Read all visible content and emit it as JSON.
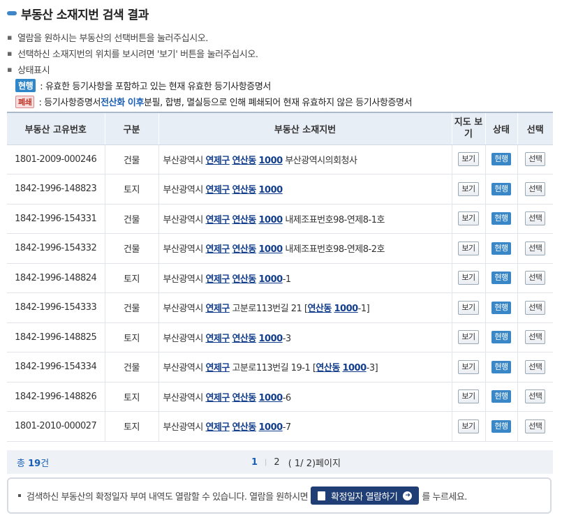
{
  "title": "부동산 소재지번 검색 결과",
  "notes": [
    "열람을 원하시는 부동산의 선택버튼을 눌러주십시오.",
    "선택하신 소재지번의 위치를 보시려면 '보기' 버튼을 눌러주십시오.",
    "상태표시"
  ],
  "legend": {
    "current_badge": "현행",
    "current_text": ": 유효한 등기사항을 포함하고 있는 현재 유효한 등기사항증명서",
    "closed_badge": "폐쇄",
    "closed_text_a": ": 등기사항증명서 ",
    "closed_text_highlight": "전산화 이후",
    "closed_text_b": " 분필, 합병, 멸실등으로 인해 폐쇄되어 현재 유효하지 않은 등기사항증명서"
  },
  "table": {
    "headers": {
      "id": "부동산 고유번호",
      "type": "구분",
      "address": "부동산 소재지번",
      "map": "지도 보기",
      "status": "상태",
      "select": "선택"
    },
    "rows": [
      {
        "id": "1801-2009-000246",
        "type": "건물",
        "prefix": "부산광역시 ",
        "gu": "연제구",
        "mid": " ",
        "dong": "연산동",
        "mid2": " ",
        "num": "1000",
        "suffix": " 부산광역시의회청사",
        "map": "보기",
        "status": "현행",
        "select": "선택"
      },
      {
        "id": "1842-1996-148823",
        "type": "토지",
        "prefix": "부산광역시 ",
        "gu": "연제구",
        "mid": " ",
        "dong": "연산동",
        "mid2": " ",
        "num": "1000",
        "suffix": "",
        "map": "보기",
        "status": "현행",
        "select": "선택"
      },
      {
        "id": "1842-1996-154331",
        "type": "건물",
        "prefix": "부산광역시 ",
        "gu": "연제구",
        "mid": " ",
        "dong": "연산동",
        "mid2": " ",
        "num": "1000",
        "suffix": " 내제조표번호98-연제8-1호",
        "map": "보기",
        "status": "현행",
        "select": "선택"
      },
      {
        "id": "1842-1996-154332",
        "type": "건물",
        "prefix": "부산광역시 ",
        "gu": "연제구",
        "mid": " ",
        "dong": "연산동",
        "mid2": " ",
        "num": "1000",
        "suffix": " 내제조표번호98-연제8-2호",
        "map": "보기",
        "status": "현행",
        "select": "선택"
      },
      {
        "id": "1842-1996-148824",
        "type": "토지",
        "prefix": "부산광역시 ",
        "gu": "연제구",
        "mid": " ",
        "dong": "연산동",
        "mid2": " ",
        "num": "1000",
        "suffix": "-1",
        "map": "보기",
        "status": "현행",
        "select": "선택"
      },
      {
        "id": "1842-1996-154333",
        "type": "건물",
        "prefix": "부산광역시 ",
        "gu": "연제구",
        "mid": " 고분로113번길 21 [",
        "dong": "연산동",
        "mid2": " ",
        "num": "1000",
        "suffix": "-1]",
        "map": "보기",
        "status": "현행",
        "select": "선택"
      },
      {
        "id": "1842-1996-148825",
        "type": "토지",
        "prefix": "부산광역시 ",
        "gu": "연제구",
        "mid": " ",
        "dong": "연산동",
        "mid2": " ",
        "num": "1000",
        "suffix": "-3",
        "map": "보기",
        "status": "현행",
        "select": "선택"
      },
      {
        "id": "1842-1996-154334",
        "type": "건물",
        "prefix": "부산광역시 ",
        "gu": "연제구",
        "mid": " 고분로113번길 19-1 [",
        "dong": "연산동",
        "mid2": " ",
        "num": "1000",
        "suffix": "-3]",
        "map": "보기",
        "status": "현행",
        "select": "선택"
      },
      {
        "id": "1842-1996-148826",
        "type": "토지",
        "prefix": "부산광역시 ",
        "gu": "연제구",
        "mid": " ",
        "dong": "연산동",
        "mid2": " ",
        "num": "1000",
        "suffix": "-6",
        "map": "보기",
        "status": "현행",
        "select": "선택"
      },
      {
        "id": "1801-2010-000027",
        "type": "토지",
        "prefix": "부산광역시 ",
        "gu": "연제구",
        "mid": " ",
        "dong": "연산동",
        "mid2": " ",
        "num": "1000",
        "suffix": "-7",
        "map": "보기",
        "status": "현행",
        "select": "선택"
      }
    ]
  },
  "pager": {
    "total_prefix": "총 ",
    "total_count": "19",
    "total_suffix": "건",
    "current_page": "1",
    "separator": "|",
    "page2": "2",
    "page_info": "( 1/ 2)페이지"
  },
  "footer": {
    "text_a": "검색하신 부동산의 확정일자 부여 내역도 열람할 수 있습니다. 열람을 원하시면",
    "button_label": "확정일자 열람하기",
    "text_b": "를 누르세요."
  },
  "colors": {
    "accent": "#2f86c8",
    "link": "#123e8c",
    "header_bg": "#e8eef5",
    "dark_button": "#1f3e75"
  }
}
